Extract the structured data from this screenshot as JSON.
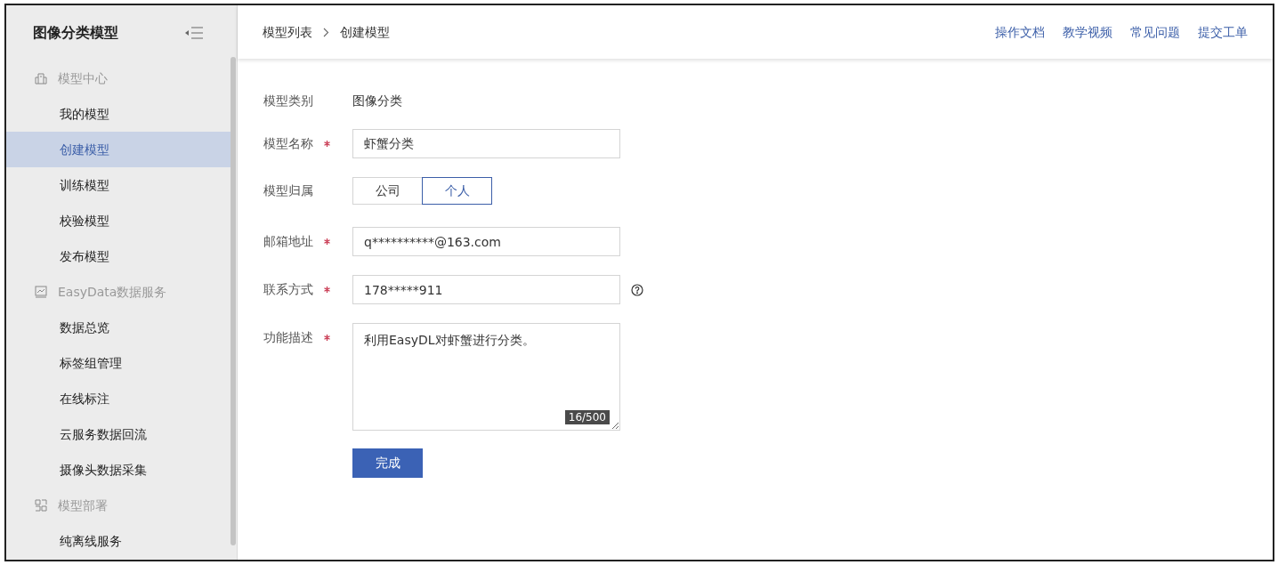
{
  "sidebar": {
    "title": "图像分类模型",
    "sections": [
      {
        "label": "模型中心",
        "items": [
          {
            "label": "我的模型",
            "selected": false
          },
          {
            "label": "创建模型",
            "selected": true
          },
          {
            "label": "训练模型",
            "selected": false
          },
          {
            "label": "校验模型",
            "selected": false
          },
          {
            "label": "发布模型",
            "selected": false
          }
        ]
      },
      {
        "label": "EasyData数据服务",
        "items": [
          {
            "label": "数据总览",
            "selected": false
          },
          {
            "label": "标签组管理",
            "selected": false
          },
          {
            "label": "在线标注",
            "selected": false
          },
          {
            "label": "云服务数据回流",
            "selected": false
          },
          {
            "label": "摄像头数据采集",
            "selected": false
          }
        ]
      },
      {
        "label": "模型部署",
        "items": [
          {
            "label": "纯离线服务",
            "selected": false
          }
        ]
      }
    ]
  },
  "breadcrumb": [
    "模型列表",
    "创建模型"
  ],
  "header_links": [
    "操作文档",
    "教学视频",
    "常见问题",
    "提交工单"
  ],
  "form": {
    "fields": [
      {
        "kind": "text",
        "label": "模型类别",
        "required": false,
        "value": "图像分类"
      },
      {
        "kind": "input",
        "label": "模型名称",
        "required": true,
        "value": "虾蟹分类",
        "help": false
      },
      {
        "kind": "segmented",
        "label": "模型归属",
        "required": false,
        "options": [
          {
            "label": "公司",
            "selected": false
          },
          {
            "label": "个人",
            "selected": true
          }
        ]
      },
      {
        "kind": "input",
        "label": "邮箱地址",
        "required": true,
        "value": "q**********@163.com",
        "help": false
      },
      {
        "kind": "input",
        "label": "联系方式",
        "required": true,
        "value": "178*****911",
        "help": true
      },
      {
        "kind": "textarea",
        "label": "功能描述",
        "required": true,
        "value": "利用EasyDL对虾蟹进行分类。",
        "counter": "16/500"
      }
    ],
    "submit": "完成"
  }
}
